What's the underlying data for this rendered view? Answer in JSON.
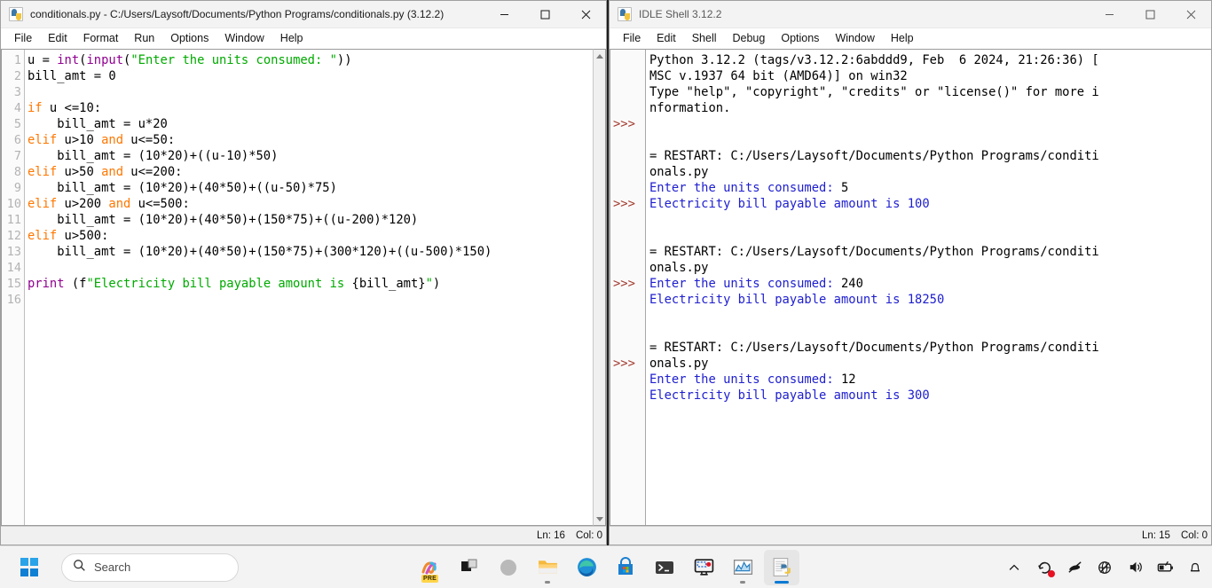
{
  "editor_window": {
    "title": "conditionals.py - C:/Users/Laysoft/Documents/Python Programs/conditionals.py (3.12.2)",
    "icon": "python-file-icon",
    "menus": [
      "File",
      "Edit",
      "Format",
      "Run",
      "Options",
      "Window",
      "Help"
    ],
    "buttons": {
      "minimize": "minimize-button",
      "maximize": "maximize-button",
      "close": "close-button"
    },
    "line_numbers": [
      "1",
      "2",
      "3",
      "4",
      "5",
      "6",
      "7",
      "8",
      "9",
      "10",
      "11",
      "12",
      "13",
      "14",
      "15",
      "16"
    ],
    "code_lines": [
      [
        {
          "t": "u = ",
          "c": "df"
        },
        {
          "t": "int",
          "c": "bi"
        },
        {
          "t": "(",
          "c": "df"
        },
        {
          "t": "input",
          "c": "bi"
        },
        {
          "t": "(",
          "c": "df"
        },
        {
          "t": "\"Enter the units consumed: \"",
          "c": "st"
        },
        {
          "t": "))",
          "c": "df"
        }
      ],
      [
        {
          "t": "bill_amt = 0",
          "c": "df"
        }
      ],
      [
        {
          "t": "",
          "c": "df"
        }
      ],
      [
        {
          "t": "if",
          "c": "kw"
        },
        {
          "t": " u <=10:",
          "c": "df"
        }
      ],
      [
        {
          "t": "    bill_amt = u*20",
          "c": "df"
        }
      ],
      [
        {
          "t": "elif",
          "c": "kw"
        },
        {
          "t": " u>10 ",
          "c": "df"
        },
        {
          "t": "and",
          "c": "kw"
        },
        {
          "t": " u<=50:",
          "c": "df"
        }
      ],
      [
        {
          "t": "    bill_amt = (10*20)+((u-10)*50)",
          "c": "df"
        }
      ],
      [
        {
          "t": "elif",
          "c": "kw"
        },
        {
          "t": " u>50 ",
          "c": "df"
        },
        {
          "t": "and",
          "c": "kw"
        },
        {
          "t": " u<=200:",
          "c": "df"
        }
      ],
      [
        {
          "t": "    bill_amt = (10*20)+(40*50)+((u-50)*75)",
          "c": "df"
        }
      ],
      [
        {
          "t": "elif",
          "c": "kw"
        },
        {
          "t": " u>200 ",
          "c": "df"
        },
        {
          "t": "and",
          "c": "kw"
        },
        {
          "t": " u<=500:",
          "c": "df"
        }
      ],
      [
        {
          "t": "    bill_amt = (10*20)+(40*50)+(150*75)+((u-200)*120)",
          "c": "df"
        }
      ],
      [
        {
          "t": "elif",
          "c": "kw"
        },
        {
          "t": " u>500:",
          "c": "df"
        }
      ],
      [
        {
          "t": "    bill_amt = (10*20)+(40*50)+(150*75)+(300*120)+((u-500)*150)",
          "c": "df"
        }
      ],
      [
        {
          "t": "",
          "c": "df"
        }
      ],
      [
        {
          "t": "print",
          "c": "bi"
        },
        {
          "t": " (f",
          "c": "df"
        },
        {
          "t": "\"Electricity bill payable amount is ",
          "c": "st"
        },
        {
          "t": "{bill_amt}",
          "c": "df"
        },
        {
          "t": "\"",
          "c": "st"
        },
        {
          "t": ")",
          "c": "df"
        }
      ],
      [
        {
          "t": "",
          "c": "df"
        }
      ]
    ],
    "status": {
      "line": "Ln: 16",
      "col": "Col: 0"
    }
  },
  "shell_window": {
    "title": "IDLE Shell 3.12.2",
    "icon": "python-file-icon",
    "menus": [
      "File",
      "Edit",
      "Shell",
      "Debug",
      "Options",
      "Window",
      "Help"
    ],
    "buttons": {
      "minimize": "minimize-button",
      "maximize": "maximize-button",
      "close": "close-button"
    },
    "prompt_symbol": ">>>",
    "prompt_rows": [
      4,
      9,
      14,
      19
    ],
    "output_lines": [
      [
        {
          "t": "Python 3.12.2 (tags/v3.12.2:6abddd9, Feb  6 2024, 21:26:36) [",
          "c": "sh-in"
        }
      ],
      [
        {
          "t": "MSC v.1937 64 bit (AMD64)] on win32",
          "c": "sh-in"
        }
      ],
      [
        {
          "t": "Type \"help\", \"copyright\", \"credits\" or \"license()\" for more i",
          "c": "sh-in"
        }
      ],
      [
        {
          "t": "nformation.",
          "c": "sh-in"
        }
      ],
      [
        {
          "t": "",
          "c": "sh-in"
        }
      ],
      [
        {
          "t": "",
          "c": "sh-in"
        }
      ],
      [
        {
          "t": "= RESTART: C:/Users/Laysoft/Documents/Python Programs/conditi",
          "c": "sh-in"
        }
      ],
      [
        {
          "t": "onals.py",
          "c": "sh-in"
        }
      ],
      [
        {
          "t": "Enter the units consumed: ",
          "c": "sh-out"
        },
        {
          "t": "5",
          "c": "sh-in"
        }
      ],
      [
        {
          "t": "Electricity bill payable amount is 100",
          "c": "sh-out"
        }
      ],
      [
        {
          "t": "",
          "c": "sh-in"
        }
      ],
      [
        {
          "t": "",
          "c": "sh-in"
        }
      ],
      [
        {
          "t": "= RESTART: C:/Users/Laysoft/Documents/Python Programs/conditi",
          "c": "sh-in"
        }
      ],
      [
        {
          "t": "onals.py",
          "c": "sh-in"
        }
      ],
      [
        {
          "t": "Enter the units consumed: ",
          "c": "sh-out"
        },
        {
          "t": "240",
          "c": "sh-in"
        }
      ],
      [
        {
          "t": "Electricity bill payable amount is 18250",
          "c": "sh-out"
        }
      ],
      [
        {
          "t": "",
          "c": "sh-in"
        }
      ],
      [
        {
          "t": "",
          "c": "sh-in"
        }
      ],
      [
        {
          "t": "= RESTART: C:/Users/Laysoft/Documents/Python Programs/conditi",
          "c": "sh-in"
        }
      ],
      [
        {
          "t": "onals.py",
          "c": "sh-in"
        }
      ],
      [
        {
          "t": "Enter the units consumed: ",
          "c": "sh-out"
        },
        {
          "t": "12",
          "c": "sh-in"
        }
      ],
      [
        {
          "t": "Electricity bill payable amount is 300",
          "c": "sh-out"
        }
      ],
      [
        {
          "t": "",
          "c": "sh-in"
        }
      ]
    ],
    "status": {
      "line": "Ln: 15",
      "col": "Col: 0"
    }
  },
  "taskbar": {
    "start": "start-button",
    "search": {
      "placeholder": "Search",
      "icon": "search-icon"
    },
    "apps": [
      {
        "name": "copilot",
        "badge": "PRE",
        "running": false
      },
      {
        "name": "task-view",
        "running": false
      },
      {
        "name": "widgets",
        "running": false
      },
      {
        "name": "file-explorer",
        "running": true
      },
      {
        "name": "microsoft-edge",
        "running": false
      },
      {
        "name": "microsoft-store",
        "running": false
      },
      {
        "name": "terminal",
        "running": false
      },
      {
        "name": "screen-recorder",
        "running": false
      },
      {
        "name": "charts-app",
        "running": true
      },
      {
        "name": "python-idle",
        "running": true,
        "active": true
      }
    ],
    "tray": [
      {
        "name": "show-hidden-icons"
      },
      {
        "name": "recording-indicator"
      },
      {
        "name": "pen-disabled"
      },
      {
        "name": "network-disconnected"
      },
      {
        "name": "volume"
      },
      {
        "name": "battery"
      },
      {
        "name": "notifications"
      }
    ]
  },
  "colors": {
    "keyword": "#ff7700",
    "builtin": "#900090",
    "string": "#00aa00",
    "shell_output": "#2020d0",
    "prompt": "#a33b2f",
    "accent": "#0a7ad4"
  }
}
